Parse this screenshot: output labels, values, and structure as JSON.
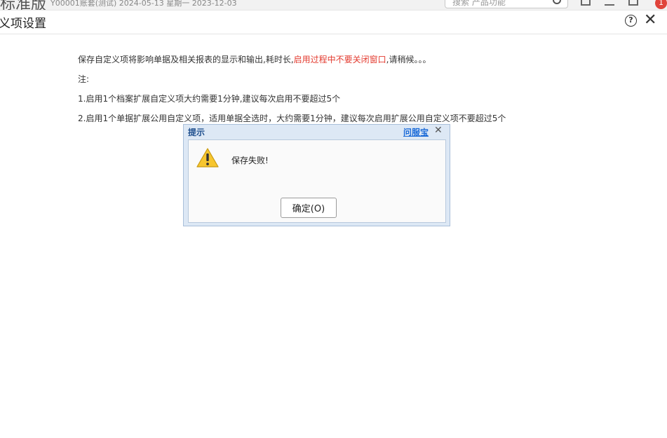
{
  "topbar": {
    "app_title": "标准版",
    "app_sub": "Y00001账套(测试) 2024-05-13 星期一 2023-12-03",
    "search_placeholder": "搜索 产品功能",
    "notify_count": "1"
  },
  "header": {
    "title": "义项设置"
  },
  "content": {
    "intro_normal": "保存自定义项将影响单据及相关报表的显示和输出,耗时长,",
    "intro_warning": "启用过程中不要关闭窗口",
    "intro_tail": ",请稍候。。。",
    "note_label": "注:",
    "note1": "1.启用1个档案扩展自定义项大约需要1分钟,建议每次启用不要超过5个",
    "note2": "2.启用1个单据扩展公用自定义项，适用单据全选时，大约需要1分钟，建议每次启用扩展公用自定义项不要超过5个"
  },
  "modal": {
    "title": "提示",
    "link": "问服宝",
    "close": "✕",
    "message": "保存失败!",
    "ok_label": "确定(O)"
  },
  "colors": {
    "warning_text": "#e33b2f",
    "link": "#1a6ad8",
    "modal_bg": "#dde8f5"
  },
  "icons": {
    "help": "question-circle",
    "close": "close-x",
    "warning": "warning-triangle"
  }
}
